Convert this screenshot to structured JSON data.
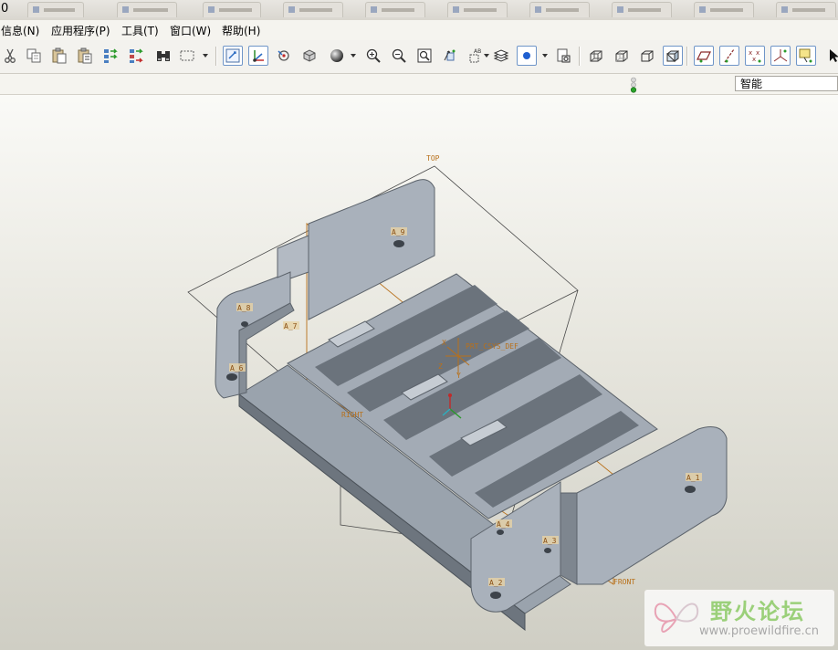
{
  "window": {
    "title_fragment": "0"
  },
  "menu": {
    "items": [
      "信息(N)",
      "应用程序(P)",
      "工具(T)",
      "窗口(W)",
      "帮助(H)"
    ]
  },
  "toolbar": {
    "buttons": [
      "cut-icon",
      "copy-icon",
      "paste-icon",
      "paste-special-icon",
      "regenerate-icon",
      "regenerate-manager-icon",
      "find-icon",
      "select-box-icon",
      "redraw-icon",
      "spin-center-icon",
      "orient-mode-icon",
      "view-manager-icon",
      "shading-icon",
      "zoom-in-icon",
      "zoom-out-icon",
      "refit-icon",
      "reorient-icon",
      "saved-views-icon",
      "layers-icon",
      "appearance-icon",
      "model-setup-icon",
      "wireframe-icon",
      "hidden-line-icon",
      "no-hidden-icon",
      "shaded-icon",
      "datum-planes-icon",
      "datum-axes-icon",
      "datum-points-icon",
      "coordinate-systems-icon",
      "annotations-icon",
      "select-arrow-icon"
    ]
  },
  "status": {
    "light_color": "#2aa12a",
    "filter_value": "智能"
  },
  "model": {
    "labels": {
      "top": "TOP",
      "right": "RIGHT",
      "front": "FRONT",
      "csys": "PRT_CSYS_DEF",
      "x": "X",
      "y": "Y",
      "z": "Z",
      "a1": "A_1",
      "a2": "A_2",
      "a3": "A_3",
      "a4": "A_4",
      "a6": "A_6",
      "a7": "A_7",
      "a8": "A_8",
      "a9": "A_9"
    },
    "colors": {
      "part": "#a8b0ba",
      "datum_label": "#b8701a"
    }
  },
  "watermark": {
    "title": "野火论坛",
    "url": "www.proewildfire.cn"
  }
}
